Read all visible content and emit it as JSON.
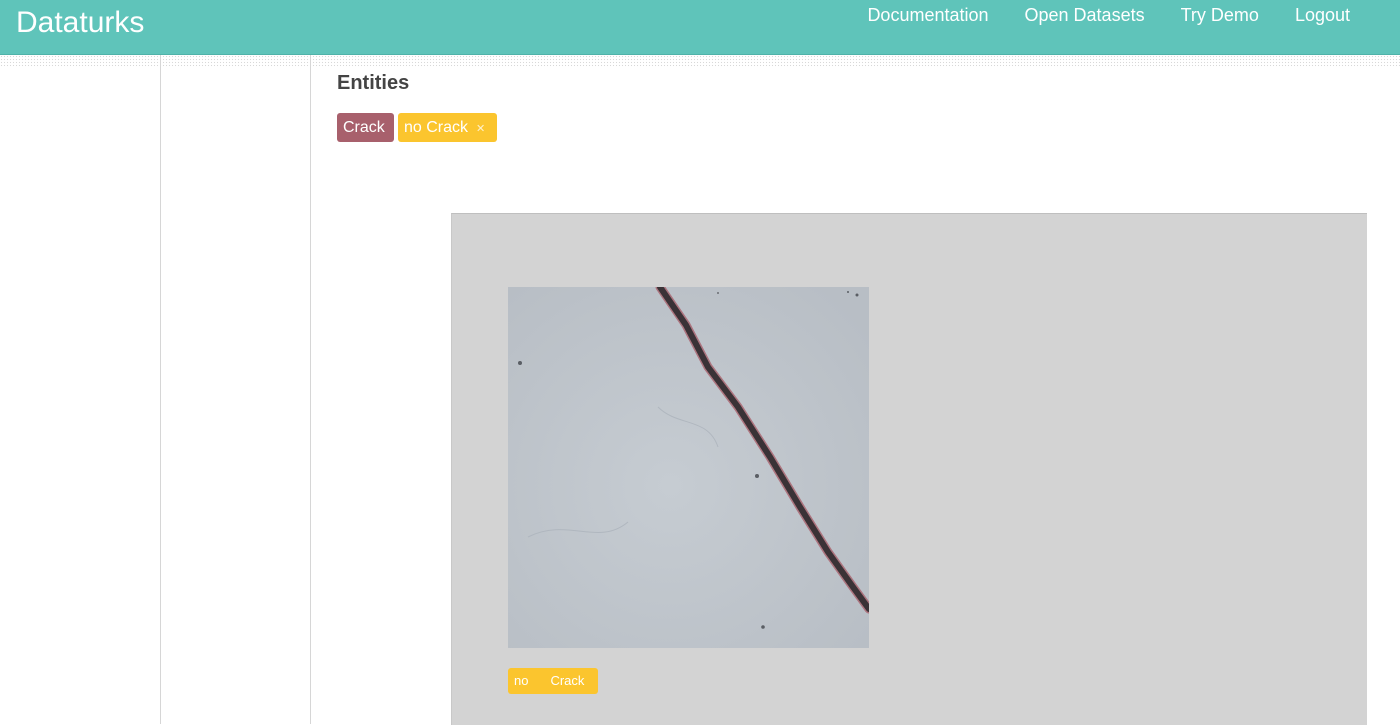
{
  "header": {
    "brand": "Dataturks",
    "nav": [
      "Documentation",
      "Open Datasets",
      "Try Demo",
      "Logout"
    ]
  },
  "entities": {
    "title": "Entities",
    "chips": [
      {
        "label": "Crack",
        "color": "#a8606c"
      },
      {
        "label": "no Crack",
        "color": "#fbc52e",
        "remove_icon": "close-icon"
      }
    ]
  },
  "annotation": {
    "label_parts": [
      "no",
      "Crack"
    ],
    "label_color": "#fbc52e"
  },
  "colors": {
    "header": "#5fc4ba",
    "panel": "#d3d3d3"
  }
}
